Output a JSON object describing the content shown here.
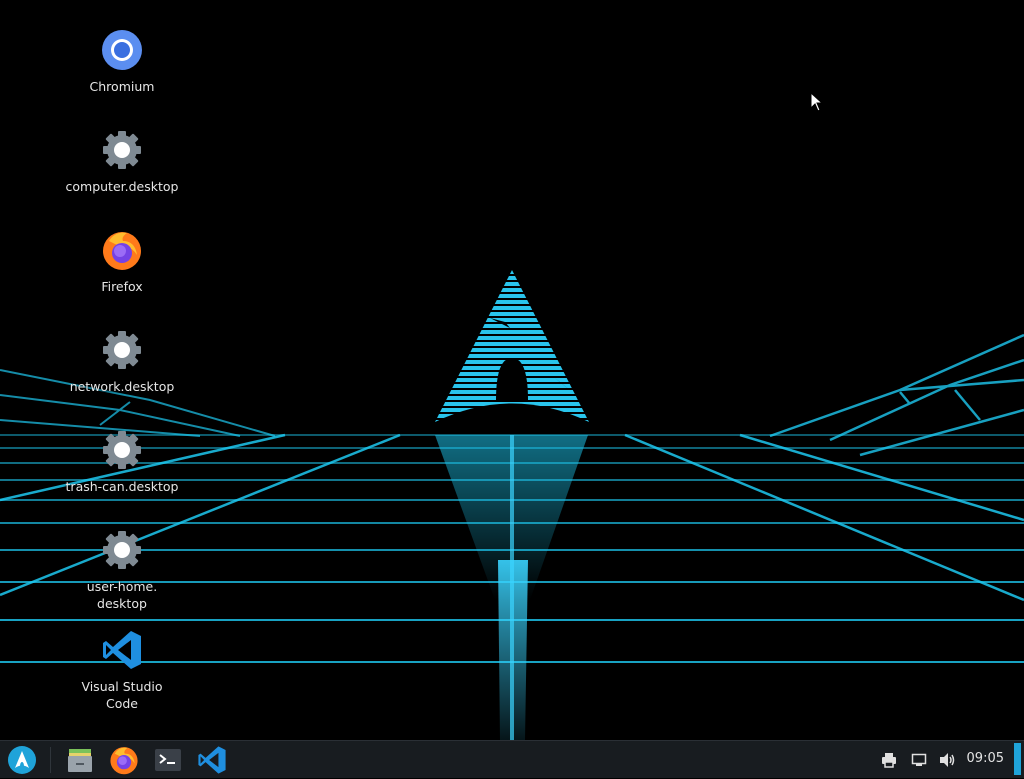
{
  "desktop": {
    "icons": [
      {
        "label": "Chromium",
        "icon": "chromium-icon"
      },
      {
        "label": "computer.desktop",
        "icon": "gear-icon"
      },
      {
        "label": "Firefox",
        "icon": "firefox-icon"
      },
      {
        "label": "network.desktop",
        "icon": "gear-icon"
      },
      {
        "label": "trash-can.desktop",
        "icon": "gear-icon"
      },
      {
        "label": "user-home.\ndesktop",
        "icon": "gear-icon"
      },
      {
        "label": "Visual Studio\nCode",
        "icon": "vscode-icon"
      }
    ]
  },
  "taskbar": {
    "launcher_icon": "arch-launcher-icon",
    "pinned": [
      "files-icon",
      "firefox-icon",
      "terminal-icon",
      "vscode-icon"
    ],
    "tray": [
      "printer-icon",
      "network-icon",
      "volume-icon"
    ],
    "clock": "09:05"
  },
  "colors": {
    "accent": "#1fa3d9",
    "grid": "#1ec8f0",
    "taskbar_bg": "#181c20"
  }
}
